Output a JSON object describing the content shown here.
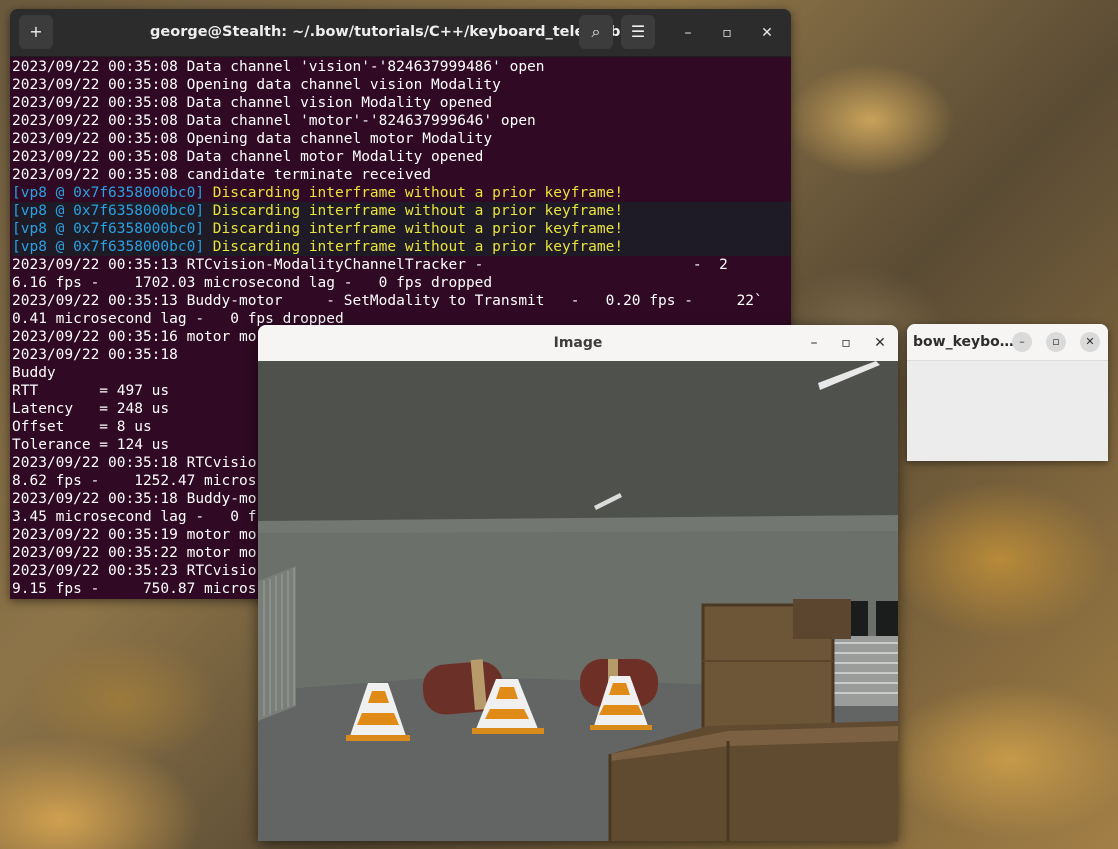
{
  "terminal": {
    "title": "george@Stealth: ~/.bow/tutorials/C++/keyboard_teleop/build",
    "new_tab_icon": "+",
    "search_icon": "⌕",
    "menu_icon": "☰",
    "minimize": "–",
    "maximize": "▫",
    "close": "✕",
    "background_color": "#300a24",
    "lines": [
      {
        "text": "2023/09/22 00:35:08 Data channel 'vision'-'824637999486' open"
      },
      {
        "text": "2023/09/22 00:35:08 Opening data channel vision Modality"
      },
      {
        "text": "2023/09/22 00:35:08 Data channel vision Modality opened"
      },
      {
        "text": "2023/09/22 00:35:08 Data channel 'motor'-'824637999646' open"
      },
      {
        "text": "2023/09/22 00:35:08 Opening data channel motor Modality"
      },
      {
        "text": "2023/09/22 00:35:08 Data channel motor Modality opened"
      },
      {
        "text": "2023/09/22 00:35:08 candidate terminate received"
      },
      {
        "prefix": "[vp8 @ 0x7f6358000bc0]",
        "text": " Discarding interframe without a prior keyframe!"
      },
      {
        "prefix": "[vp8 @ 0x7f6358000bc0]",
        "text": " Discarding interframe without a prior keyframe!",
        "highlight": true
      },
      {
        "prefix": "[vp8 @ 0x7f6358000bc0]",
        "text": " Discarding interframe without a prior keyframe!",
        "highlight": true
      },
      {
        "prefix": "[vp8 @ 0x7f6358000bc0]",
        "text": " Discarding interframe without a prior keyframe!",
        "highlight": true
      },
      {
        "text": "2023/09/22 00:35:13 RTCvision-ModalityChannelTracker -                        -  2"
      },
      {
        "text": "6.16 fps -    1702.03 microsecond lag -   0 fps dropped"
      },
      {
        "text": "2023/09/22 00:35:13 Buddy-motor     - SetModality to Transmit   -   0.20 fps -     22`"
      },
      {
        "text": "0.41 microsecond lag -   0 fps dropped"
      },
      {
        "text": "2023/09/22 00:35:16 motor mo"
      },
      {
        "text": "2023/09/22 00:35:18"
      },
      {
        "text": "Buddy"
      },
      {
        "text": "RTT       = 497 us"
      },
      {
        "text": "Latency   = 248 us"
      },
      {
        "text": "Offset    = 8 us"
      },
      {
        "text": "Tolerance = 124 us"
      },
      {
        "text": "2023/09/22 00:35:18 RTCvisio"
      },
      {
        "text": "8.62 fps -    1252.47 micros"
      },
      {
        "text": "2023/09/22 00:35:18 Buddy-mo"
      },
      {
        "text": "3.45 microsecond lag -   0 f"
      },
      {
        "text": "2023/09/22 00:35:19 motor mo"
      },
      {
        "text": "2023/09/22 00:35:22 motor mo"
      },
      {
        "text": "2023/09/22 00:35:23 RTCvisio"
      },
      {
        "text": "9.15 fps -     750.87 micros"
      }
    ]
  },
  "image_window": {
    "title": "Image",
    "minimize": "–",
    "maximize": "▫",
    "close": "✕"
  },
  "small_window": {
    "title": "bow_keyboard_teleop",
    "minimize": "–",
    "maximize": "▫",
    "close": "✕"
  }
}
